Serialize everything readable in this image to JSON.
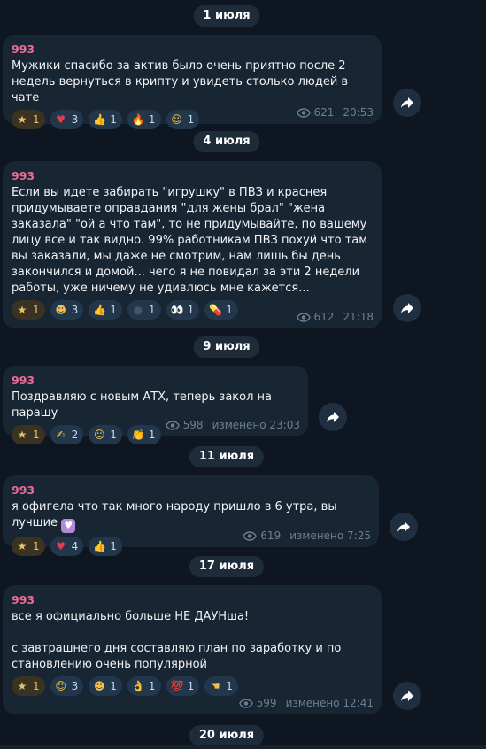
{
  "dates": [
    "1 июля",
    "4 июля",
    "9 июля",
    "11 июля",
    "17 июля",
    "20 июля"
  ],
  "messages": [
    {
      "author": "993",
      "text": "Мужики спасибо за актив было очень приятно после 2 недель вернуться в крипту и увидеть столько людей в чате",
      "reactions": [
        {
          "icon": "star-icon",
          "glyph": "★",
          "count": "1"
        },
        {
          "icon": "heart-icon",
          "glyph": "♥",
          "count": "3"
        },
        {
          "icon": "thumbs-up-icon",
          "glyph": "👍",
          "count": "1"
        },
        {
          "icon": "fire-icon",
          "glyph": "🔥",
          "count": "1"
        },
        {
          "icon": "hugging-face-icon",
          "glyph": "☺",
          "count": "1"
        }
      ],
      "views": "621",
      "time": "20:53"
    },
    {
      "author": "993",
      "text": "Если вы идете забирать \"игрушку\" в ПВЗ и краснея придумываете оправдания \"для жены брал\" \"жена заказала\" \"ой а что там\", то не придумывайте, по вашему лицу все и так видно. 99% работникам ПВЗ похуй что там вы заказали, мы даже не смотрим, нам лишь бы день закончился и домой... чего я не повидал за эти 2 недели работы, уже ничему не удивлюсь мне кажется...",
      "reactions": [
        {
          "icon": "star-icon",
          "glyph": "★",
          "count": "1"
        },
        {
          "icon": "grimacing-face-icon",
          "glyph": "☻",
          "count": "3"
        },
        {
          "icon": "thumbs-up-icon",
          "glyph": "👍",
          "count": "1"
        },
        {
          "icon": "new-moon-face-icon",
          "glyph": "●",
          "count": "1"
        },
        {
          "icon": "eyes-icon",
          "glyph": "👀",
          "count": "1"
        },
        {
          "icon": "pill-icon",
          "glyph": "💊",
          "count": "1"
        }
      ],
      "views": "612",
      "time": "21:18"
    },
    {
      "author": "993",
      "text": "Поздравляю с новым АТХ, теперь закол на парашу",
      "reactions": [
        {
          "icon": "star-icon",
          "glyph": "★",
          "count": "1"
        },
        {
          "icon": "writing-hand-icon",
          "glyph": "✍",
          "count": "2"
        },
        {
          "icon": "smiling-face-hearts-icon",
          "glyph": "☺",
          "count": "1"
        },
        {
          "icon": "clapping-hands-icon",
          "glyph": "👏",
          "count": "1"
        }
      ],
      "views": "598",
      "time": "изменено 23:03"
    },
    {
      "author": "993",
      "text": "я офигела что так много народу пришло в 6 утра, вы лучшие",
      "reactions": [
        {
          "icon": "star-icon",
          "glyph": "★",
          "count": "1"
        },
        {
          "icon": "heart-icon",
          "glyph": "♥",
          "count": "4"
        },
        {
          "icon": "thumbs-up-icon",
          "glyph": "👍",
          "count": "1"
        }
      ],
      "views": "619",
      "time": "изменено 7:25"
    },
    {
      "author": "993",
      "text": "все я официально больше НЕ ДАУНша!\n\nс завтрашнего дня составляю план по заработку и по становлению очень популярной",
      "reactions": [
        {
          "icon": "star-icon",
          "glyph": "★",
          "count": "1"
        },
        {
          "icon": "rofl-face-icon",
          "glyph": "☺",
          "count": "3"
        },
        {
          "icon": "grimacing-face-icon",
          "glyph": "☻",
          "count": "1"
        },
        {
          "icon": "ok-hand-icon",
          "glyph": "👌",
          "count": "1"
        },
        {
          "icon": "hundred-points-icon",
          "glyph": "💯",
          "count": "1"
        },
        {
          "icon": "pointing-hand-icon",
          "glyph": "☚",
          "count": "1"
        }
      ],
      "views": "599",
      "time": "изменено 12:41"
    }
  ],
  "colors": {
    "background": "#0e1621",
    "bubble": "#182533",
    "author": "#ee6a95",
    "date_pill": "#1e2c3a",
    "reaction": "#22364c",
    "reaction_paid": "#3a3223"
  }
}
